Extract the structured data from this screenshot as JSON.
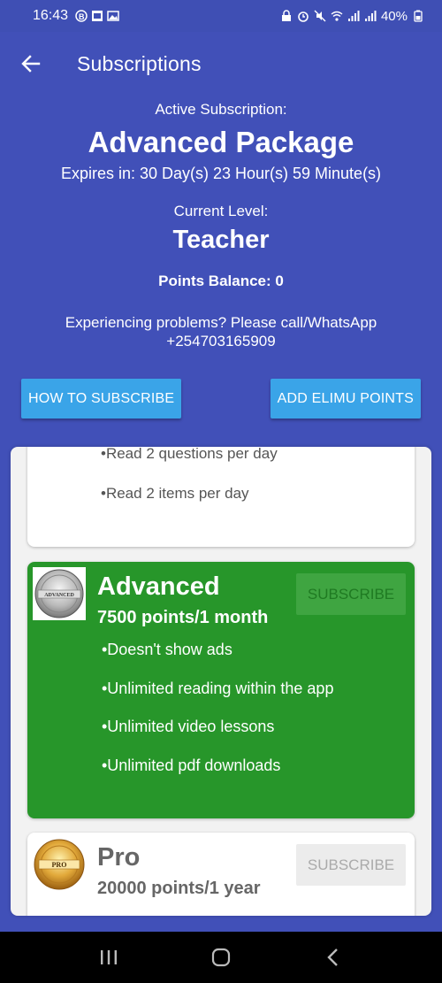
{
  "status_bar": {
    "time": "16:43",
    "battery": "40%"
  },
  "app_bar": {
    "title": "Subscriptions"
  },
  "header": {
    "active_label": "Active Subscription:",
    "package_name": "Advanced Package",
    "expires": "Expires in: 30 Day(s) 23 Hour(s) 59 Minute(s)",
    "level_label": "Current Level:",
    "level": "Teacher",
    "points_balance": "Points Balance: 0",
    "problems_line1": "Experiencing problems? Please call/WhatsApp",
    "problems_line2": "+254703165909"
  },
  "buttons": {
    "how_to_subscribe": "HOW TO SUBSCRIBE",
    "add_points": "ADD ELIMU POINTS"
  },
  "packages": {
    "basic": {
      "features": [
        "•Read 2 questions per day",
        "•Read 2 items per day"
      ]
    },
    "advanced": {
      "badge": "ADVANCED",
      "name": "Advanced",
      "price": "7500 points/1 month",
      "subscribe": "SUBSCRIBE",
      "features": [
        "•Doesn't show ads",
        "•Unlimited reading within the app",
        "•Unlimited video lessons",
        "•Unlimited pdf downloads"
      ]
    },
    "pro": {
      "badge": "PRO",
      "name": "Pro",
      "price": "20000 points/1 year",
      "subscribe": "SUBSCRIBE"
    }
  },
  "colors": {
    "primary": "#4150b8",
    "accent_button": "#3aa4e8",
    "advanced_card": "#27962a"
  }
}
